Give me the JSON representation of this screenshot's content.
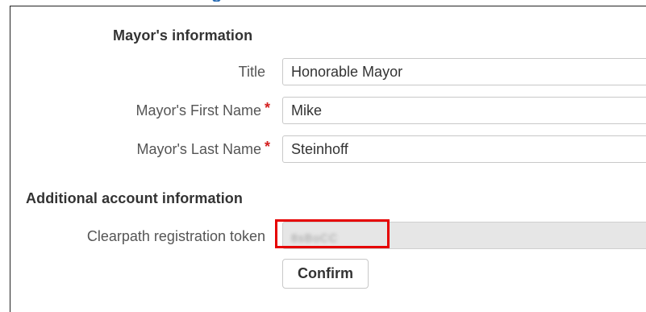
{
  "header": {
    "clipped_heading": "g"
  },
  "mayor_section": {
    "title": "Mayor's information",
    "fields": [
      {
        "label": "Title",
        "required": false,
        "value": "Honorable Mayor"
      },
      {
        "label": "Mayor's First Name",
        "required": true,
        "value": "Mike"
      },
      {
        "label": "Mayor's Last Name",
        "required": true,
        "value": "Steinhoff"
      }
    ],
    "required_marker": "*"
  },
  "account_section": {
    "title": "Additional account information",
    "token_label": "Clearpath registration token",
    "token_value": "8sBoCC",
    "confirm_label": "Confirm"
  },
  "colors": {
    "accent_heading": "#2a6db5",
    "required": "#d42020",
    "highlight": "#e60000",
    "disabled_bg": "#e6e6e6"
  }
}
